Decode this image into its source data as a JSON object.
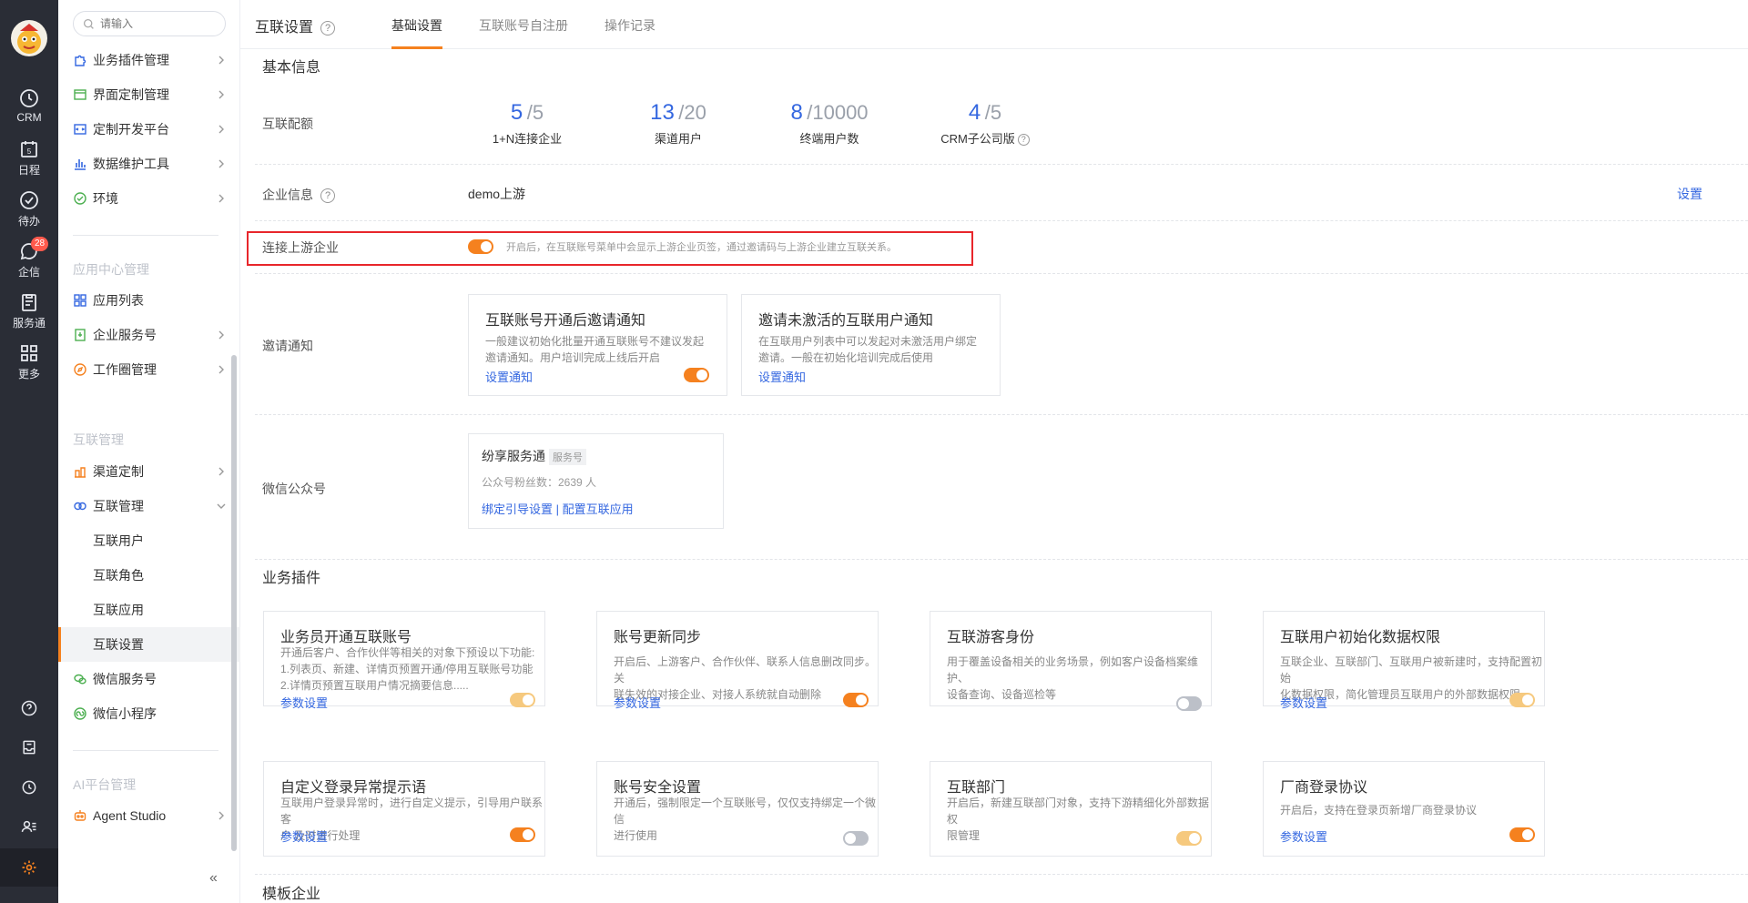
{
  "rail": {
    "items": [
      {
        "label": "CRM",
        "icon": "clock-icon"
      },
      {
        "label": "日程",
        "icon": "calendar-icon",
        "badge_text": "5"
      },
      {
        "label": "待办",
        "icon": "check-circle-icon"
      },
      {
        "label": "企信",
        "icon": "chat-icon",
        "badge": "28"
      },
      {
        "label": "服务通",
        "icon": "clipboard-icon"
      },
      {
        "label": "更多",
        "icon": "grid-icon"
      }
    ]
  },
  "sidebar": {
    "search_placeholder": "请输入",
    "items_top": [
      {
        "label": "业务插件管理"
      },
      {
        "label": "界面定制管理"
      },
      {
        "label": "定制开发平台"
      },
      {
        "label": "数据维护工具"
      },
      {
        "label": "环境"
      }
    ],
    "group_app": "应用中心管理",
    "items_app": [
      {
        "label": "应用列表"
      },
      {
        "label": "企业服务号"
      },
      {
        "label": "工作圈管理"
      }
    ],
    "group_link": "互联管理",
    "items_link": [
      {
        "label": "渠道定制"
      },
      {
        "label": "互联管理"
      }
    ],
    "sub_items": [
      {
        "label": "互联用户"
      },
      {
        "label": "互联角色"
      },
      {
        "label": "互联应用"
      },
      {
        "label": "互联设置"
      }
    ],
    "items_link2": [
      {
        "label": "微信服务号"
      },
      {
        "label": "微信小程序"
      }
    ],
    "group_ai": "AI平台管理",
    "items_ai": [
      {
        "label": "Agent Studio"
      }
    ],
    "collapse": "«"
  },
  "topbar": {
    "title": "互联设置",
    "help": "?",
    "tabs": [
      "基础设置",
      "互联账号自注册",
      "操作记录"
    ]
  },
  "basic": {
    "title": "基本信息",
    "quota_label": "互联配额",
    "quotas": [
      {
        "value": "5",
        "max": "/5",
        "label": "1+N连接企业"
      },
      {
        "value": "13",
        "max": "/20",
        "label": "渠道用户"
      },
      {
        "value": "8",
        "max": "/10000",
        "label": "终端用户数"
      },
      {
        "value": "4",
        "max": "/5",
        "label": "CRM子公司版"
      }
    ],
    "company_label": "企业信息",
    "company_name": "demo上游",
    "company_action": "设置",
    "connect_label": "连接上游企业",
    "connect_desc": "开启后，在互联账号菜单中会显示上游企业页签，通过邀请码与上游企业建立互联关系。",
    "invite_label": "邀请通知",
    "invite_cards": [
      {
        "title": "互联账号开通后邀请通知",
        "desc1": "一般建议初始化批量开通互联账号不建议发起",
        "desc2": "邀请通知。用户培训完成上线后开启",
        "link": "设置通知"
      },
      {
        "title": "邀请未激活的互联用户通知",
        "desc1": "在互联用户列表中可以发起对未激活用户绑定",
        "desc2": "邀请。一般在初始化培训完成后使用",
        "link": "设置通知"
      }
    ],
    "wechat_label": "微信公众号",
    "wechat": {
      "name": "纷享服务通",
      "tag": "服务号",
      "fans": "公众号粉丝数：2639 人",
      "link1": "绑定引导设置",
      "sep": "|",
      "link2": "配置互联应用"
    }
  },
  "plugins": {
    "title": "业务插件",
    "cards": [
      {
        "title": "业务员开通互联账号",
        "lines": [
          "开通后客户、合作伙伴等相关的对象下预设以下功能:",
          "1.列表页、新建、详情页预置开通/停用互联账号功能",
          "2.详情页预置互联用户情况摘要信息....."
        ],
        "link": "参数设置",
        "toggle": "light"
      },
      {
        "title": "账号更新同步",
        "lines": [
          "开启后、上游客户、合作伙伴、联系人信息删改同步。关",
          "联失效的对接企业、对接人系统就自动删除"
        ],
        "link": "参数设置",
        "toggle": "on"
      },
      {
        "title": "互联游客身份",
        "lines": [
          "用于覆盖设备相关的业务场景，例如客户设备档案维护、",
          "设备查询、设备巡检等"
        ],
        "link": "",
        "toggle": "off"
      },
      {
        "title": "互联用户初始化数据权限",
        "lines": [
          "互联企业、互联部门、互联用户被新建时，支持配置初始",
          "化数据权限，简化管理员互联用户的外部数据权限。"
        ],
        "link": "参数设置",
        "toggle": "light"
      },
      {
        "title": "自定义登录异常提示语",
        "lines": [
          "互联用户登录异常时，进行自定义提示，引导用户联系客",
          "户 及时进行处理"
        ],
        "link": "参数设置",
        "toggle": "on"
      },
      {
        "title": "账号安全设置",
        "lines": [
          "开通后，强制限定一个互联账号，仅仅支持绑定一个微信",
          "进行使用"
        ],
        "link": "",
        "toggle": "off"
      },
      {
        "title": "互联部门",
        "lines": [
          "开启后，新建互联部门对象，支持下游精细化外部数据权",
          "限管理"
        ],
        "link": "",
        "toggle": "light"
      },
      {
        "title": "厂商登录协议",
        "lines": [
          "开启后，支持在登录页新增厂商登录协议"
        ],
        "link": "参数设置",
        "toggle": "on"
      }
    ]
  },
  "template": {
    "title": "模板企业"
  },
  "colors": {
    "accent": "#f5811f",
    "link": "#3467e0",
    "highlight": "#e8262b"
  }
}
